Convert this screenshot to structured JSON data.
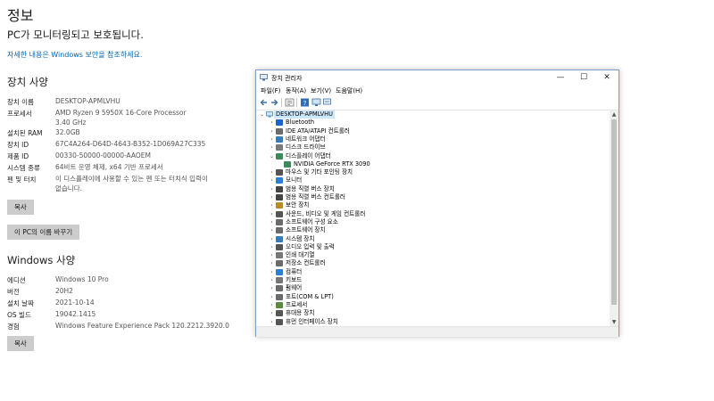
{
  "page": {
    "title": "정보",
    "monitor_text": "PC가 모니터링되고 보호됩니다.",
    "security_link": "자세한 내용은 Windows 보안을 참조하세요."
  },
  "device_spec": {
    "heading": "장치 사양",
    "rows": [
      {
        "label": "장치 이름",
        "value": "DESKTOP-APMLVHU"
      },
      {
        "label": "프로세서",
        "value": "AMD Ryzen 9 5950X 16-Core Processor",
        "value2": "3.40 GHz"
      },
      {
        "label": "설치된 RAM",
        "value": "32.0GB"
      },
      {
        "label": "장치 ID",
        "value": "67C4A264-D64D-4643-B352-1D069A27C335"
      },
      {
        "label": "제품 ID",
        "value": "00330-50000-00000-AAOEM"
      },
      {
        "label": "시스템 종류",
        "value": "64비트 운영 체제, x64 기반 프로세서"
      },
      {
        "label": "펜 및 터치",
        "value": "이 디스플레이에 사용할 수 있는 펜 또는 터치식 입력이 없습니다."
      }
    ],
    "copy_button": "복사",
    "rename_button": "이 PC의 이름 바꾸기"
  },
  "windows_spec": {
    "heading": "Windows 사양",
    "rows": [
      {
        "label": "에디션",
        "value": "Windows 10 Pro"
      },
      {
        "label": "버전",
        "value": "20H2"
      },
      {
        "label": "설치 날짜",
        "value": "2021-10-14"
      },
      {
        "label": "OS 빌드",
        "value": "19042.1415"
      },
      {
        "label": "경험",
        "value": "Windows Feature Experience Pack 120.2212.3920.0"
      }
    ],
    "copy_button": "복사"
  },
  "device_manager": {
    "title": "장치 관리자",
    "window_controls": {
      "minimize": "—",
      "maximize": "☐",
      "close": "✕"
    },
    "menu": [
      "파일(F)",
      "동작(A)",
      "보기(V)",
      "도움말(H)"
    ],
    "toolbar_icons": [
      "back-icon",
      "forward-icon",
      "properties-icon",
      "help-icon",
      "computer-monitor-icon"
    ],
    "root": "DESKTOP-APMLVHU",
    "nodes": [
      {
        "label": "Bluetooth",
        "icon": "bluetooth-icon",
        "color": "#1e64c8",
        "expanded": false
      },
      {
        "label": "IDE ATA/ATAPI 컨트롤러",
        "icon": "ide-controller-icon",
        "color": "#6b6b6b",
        "expanded": false
      },
      {
        "label": "네트워크 어댑터",
        "icon": "network-adapter-icon",
        "color": "#3a7ab8",
        "expanded": false
      },
      {
        "label": "디스크 드라이브",
        "icon": "disk-drive-icon",
        "color": "#7a7a7a",
        "expanded": false
      },
      {
        "label": "디스플레이 어댑터",
        "icon": "display-adapter-icon",
        "color": "#3a8a5a",
        "expanded": true,
        "children": [
          {
            "label": "NVIDIA GeForce RTX 3090",
            "icon": "display-adapter-icon",
            "color": "#3a8a5a"
          }
        ]
      },
      {
        "label": "마우스 및 기타 포인팅 장치",
        "icon": "mouse-icon",
        "color": "#555555",
        "expanded": false
      },
      {
        "label": "모니터",
        "icon": "monitor-icon",
        "color": "#2f7fd0",
        "expanded": false
      },
      {
        "label": "범용 직렬 버스 장치",
        "icon": "usb-icon",
        "color": "#444444",
        "expanded": false
      },
      {
        "label": "범용 직렬 버스 컨트롤러",
        "icon": "usb-icon",
        "color": "#444444",
        "expanded": false
      },
      {
        "label": "보안 장치",
        "icon": "security-device-icon",
        "color": "#b88a2a",
        "expanded": false
      },
      {
        "label": "사운드, 비디오 및 게임 컨트롤러",
        "icon": "speaker-icon",
        "color": "#555555",
        "expanded": false
      },
      {
        "label": "소프트웨어 구성 요소",
        "icon": "software-component-icon",
        "color": "#6b6b6b",
        "expanded": false
      },
      {
        "label": "소프트웨어 장치",
        "icon": "software-device-icon",
        "color": "#6b6b6b",
        "expanded": false
      },
      {
        "label": "시스템 장치",
        "icon": "system-device-icon",
        "color": "#3a7ab8",
        "expanded": false
      },
      {
        "label": "오디오 입력 및 출력",
        "icon": "audio-icon",
        "color": "#555555",
        "expanded": false
      },
      {
        "label": "인쇄 대기열",
        "icon": "printer-icon",
        "color": "#777777",
        "expanded": false
      },
      {
        "label": "저장소 컨트롤러",
        "icon": "storage-controller-icon",
        "color": "#6b6b6b",
        "expanded": false
      },
      {
        "label": "컴퓨터",
        "icon": "computer-icon",
        "color": "#2f7fd0",
        "expanded": false
      },
      {
        "label": "키보드",
        "icon": "keyboard-icon",
        "color": "#777777",
        "expanded": false
      },
      {
        "label": "펌웨어",
        "icon": "firmware-icon",
        "color": "#6b6b6b",
        "expanded": false
      },
      {
        "label": "포트(COM & LPT)",
        "icon": "port-icon",
        "color": "#6b6b6b",
        "expanded": false
      },
      {
        "label": "프로세서",
        "icon": "processor-icon",
        "color": "#5a8a3a",
        "expanded": false
      },
      {
        "label": "휴대용 장치",
        "icon": "portable-device-icon",
        "color": "#555555",
        "expanded": false
      },
      {
        "label": "휴먼 인터페이스 장치",
        "icon": "hid-icon",
        "color": "#555555",
        "expanded": false
      }
    ]
  }
}
